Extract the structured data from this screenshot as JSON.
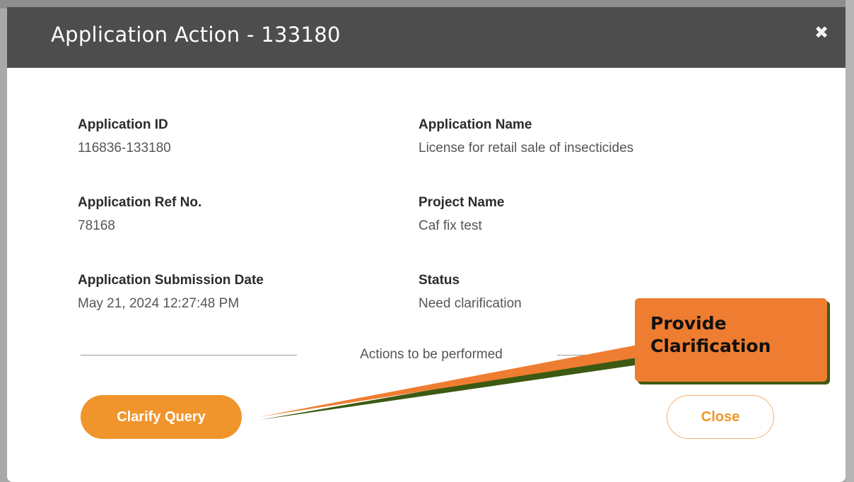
{
  "modal": {
    "title": "Application Action - 133180",
    "close_icon": "close-x-icon"
  },
  "fields": {
    "application_id": {
      "label": "Application ID",
      "value": "116836-133180"
    },
    "application_name": {
      "label": "Application Name",
      "value": "License for retail sale of insecticides"
    },
    "application_ref_no": {
      "label": "Application Ref No.",
      "value": "78168"
    },
    "project_name": {
      "label": "Project Name",
      "value": "Caf fix test"
    },
    "submission_date": {
      "label": "Application Submission Date",
      "value": "May 21, 2024 12:27:48 PM"
    },
    "status": {
      "label": "Status",
      "value": "Need clarification"
    }
  },
  "actions": {
    "caption": "Actions to be performed",
    "clarify_label": "Clarify Query",
    "close_label": "Close"
  },
  "callout": {
    "text": "Provide\nClarification"
  },
  "colors": {
    "header_bg": "#4d4d4d",
    "accent_orange": "#f0952b",
    "callout_bg": "#ee7d31",
    "callout_shadow": "#3c5a12"
  }
}
